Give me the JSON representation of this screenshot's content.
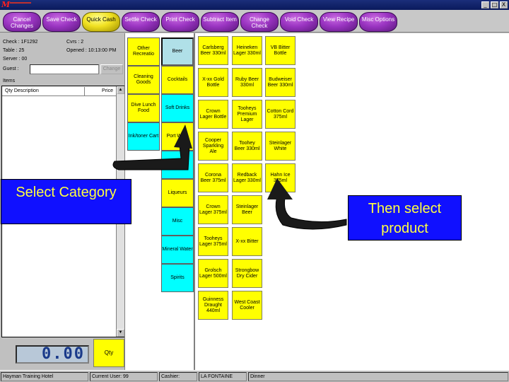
{
  "title": {
    "logo": "M"
  },
  "window_buttons": [
    "_",
    "□",
    "X"
  ],
  "toolbar": [
    {
      "label": "Cancel Changes",
      "color": "purple"
    },
    {
      "label": "Save Check",
      "color": "purple"
    },
    {
      "label": "Quick Cash",
      "color": "yellow"
    },
    {
      "label": "Settle Check",
      "color": "purple"
    },
    {
      "label": "Print Check",
      "color": "purple"
    },
    {
      "label": "Subtract Item",
      "color": "purple"
    },
    {
      "label": "Change Check",
      "color": "purple"
    },
    {
      "label": "Void Check",
      "color": "purple"
    },
    {
      "label": "View Recipe",
      "color": "purple"
    },
    {
      "label": "Misc Options",
      "color": "purple"
    }
  ],
  "check_info": {
    "check_label": "Check : 1F1292",
    "covers_label": "Cvrs : 2",
    "table_label": "Table : 25",
    "opened_label": "Opened : 10:13:00 PM",
    "server_label": "Server : 00",
    "guest_label": "Guest :",
    "guest_value": "",
    "change_button": "Change"
  },
  "items": {
    "label": "Items",
    "header_qty_desc": "Qty Description",
    "header_price": "Price"
  },
  "display_value": "0.00",
  "qty_button": "Qty",
  "status": {
    "site": "Hayman Training Hotel",
    "user": "Current User: 99",
    "cashier_label": "Cashier:",
    "cashier": "LA FONTAINE",
    "meal": "Dinner"
  },
  "categories": [
    {
      "label": "Other Recreatio",
      "color": "yellow"
    },
    {
      "label": "Beer",
      "color": "selected"
    },
    {
      "label": "Cleaning Goods",
      "color": "yellow"
    },
    {
      "label": "Cocktails",
      "color": "yellow"
    },
    {
      "label": "Dive Lunch Food",
      "color": "yellow"
    },
    {
      "label": "Soft Drinks",
      "color": "cyan"
    },
    {
      "label": "Ink/toner Cart",
      "color": "cyan"
    },
    {
      "label": "Port Wine",
      "color": "yellow"
    },
    {
      "label": "",
      "color": "cyan"
    },
    {
      "label": "Liqueurs",
      "color": "yellow"
    },
    {
      "label": "Misc",
      "color": "cyan"
    },
    {
      "label": "Mineral Water",
      "color": "cyan"
    },
    {
      "label": "Spirits",
      "color": "cyan"
    }
  ],
  "products": [
    [
      "Carlsberg Beer 330ml",
      "Heineken Lager 330ml",
      "VB Bitter Bottle"
    ],
    [
      "X-xx Gold Bottle",
      "Ruby Beer 330ml",
      "Budweiser Beer 330ml"
    ],
    [
      "Crown Lager Bottle",
      "Tooheys Premium Lager",
      "Cotton Cord 375ml"
    ],
    [
      "Cooper Sparkling Ale",
      "Toohey Beer 330ml",
      "Steinlager White"
    ],
    [
      "Corona Beer 375ml",
      "Redback Lager 330ml",
      "Hahn Ice 375ml"
    ],
    [
      "Crown Lager 375ml",
      "Steinlager Beer",
      ""
    ],
    [
      "Tooheys Lager 375ml",
      "X-xx Bitter",
      ""
    ],
    [
      "Grolsch Lager 500ml",
      "Strongbow Dry Cider",
      ""
    ],
    [
      "Guinness Draught 440ml",
      "West Coast Cooler",
      ""
    ]
  ],
  "callouts": {
    "left": "Select Category",
    "right": "Then select product"
  }
}
